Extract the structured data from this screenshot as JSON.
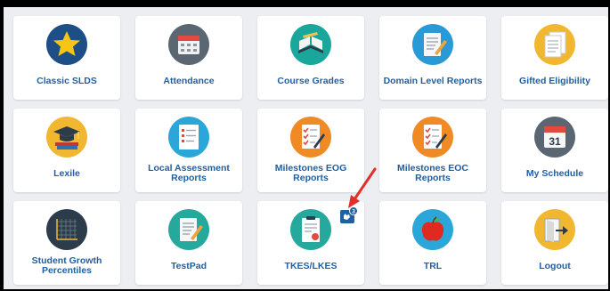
{
  "tiles": [
    {
      "label": "Classic SLDS",
      "icon": "star-icon"
    },
    {
      "label": "Attendance",
      "icon": "calendar-grid-icon"
    },
    {
      "label": "Course Grades",
      "icon": "open-book-icon"
    },
    {
      "label": "Domain Level Reports",
      "icon": "notepad-pencil-icon"
    },
    {
      "label": "Gifted Eligibility",
      "icon": "document-stack-icon"
    },
    {
      "label": "Lexile",
      "icon": "graduation-cap-icon"
    },
    {
      "label": "Local Assessment Reports",
      "icon": "checklist-icon"
    },
    {
      "label": "Milestones EOG Reports",
      "icon": "checklist-clipboard-icon"
    },
    {
      "label": "Milestones EOC Reports",
      "icon": "checklist-clipboard-icon"
    },
    {
      "label": "My Schedule",
      "icon": "calendar-31-icon"
    },
    {
      "label": "Student Growth Percentiles",
      "icon": "growth-chart-icon"
    },
    {
      "label": "TestPad",
      "icon": "notepad-pencil-icon"
    },
    {
      "label": "TKES/LKES",
      "icon": "clipboard-apple-icon"
    },
    {
      "label": "TRL",
      "icon": "apple-icon"
    },
    {
      "label": "Logout",
      "icon": "exit-door-icon"
    }
  ],
  "calendar_day": "31",
  "notification_badge": {
    "count": "3",
    "icon": "hand-notification-icon"
  },
  "colors": {
    "label": "#1f5fa3",
    "background": "#eceef2",
    "arrow": "#e0302b"
  }
}
